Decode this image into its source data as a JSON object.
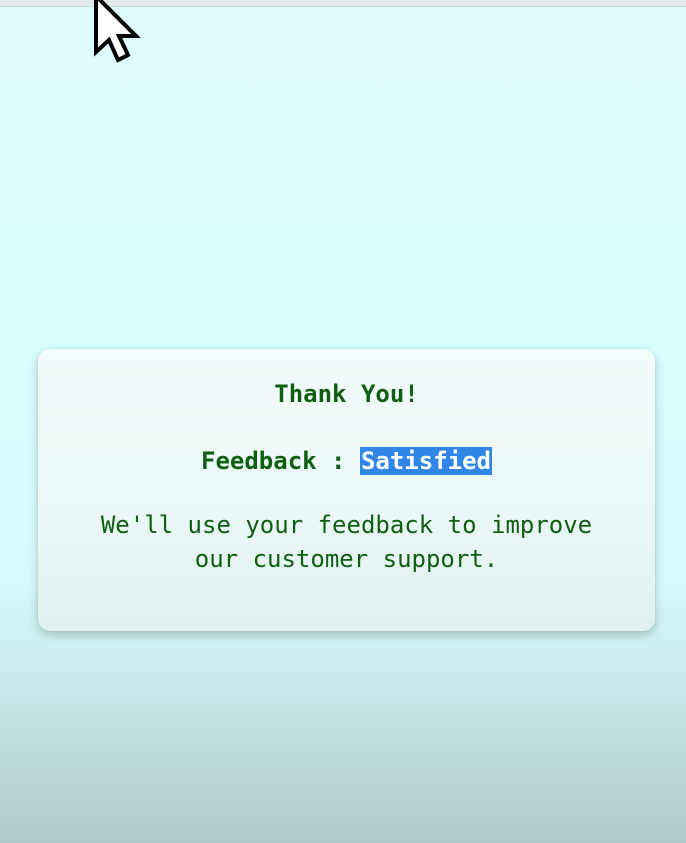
{
  "card": {
    "title": "Thank You!",
    "feedback_label": "Feedback : ",
    "feedback_value": "Satisfied",
    "message": "We'll use your feedback to improve our customer support."
  },
  "colors": {
    "text": "#0f5f12",
    "selection": "#2f86e6",
    "background": "#d9fefe"
  },
  "cursor": {
    "icon": "arrow-pointer-icon"
  }
}
